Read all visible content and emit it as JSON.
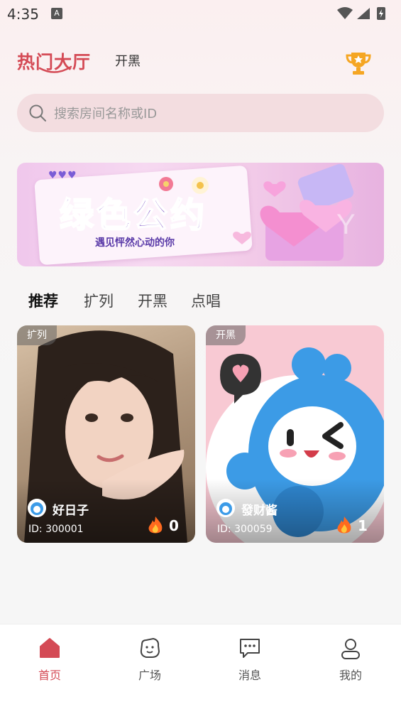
{
  "status_bar": {
    "time": "4:35",
    "notification_icon": "A"
  },
  "header": {
    "title": "热门大厅",
    "secondary_tab": "开黑",
    "trophy_icon": "trophy-icon"
  },
  "search": {
    "placeholder": "搜索房间名称或ID",
    "value": ""
  },
  "banner": {
    "title": "绿色公约",
    "subtitle": "遇见怦然心动的你"
  },
  "categories": [
    {
      "label": "推荐",
      "active": true
    },
    {
      "label": "扩列",
      "active": false
    },
    {
      "label": "开黑",
      "active": false
    },
    {
      "label": "点唱",
      "active": false
    }
  ],
  "rooms": [
    {
      "tag": "扩列",
      "name": "好日子",
      "id": "ID: 300001",
      "heat": "0"
    },
    {
      "tag": "开黑",
      "name": "發财酱",
      "id": "ID: 300059",
      "heat": "1"
    }
  ],
  "bottom_nav": [
    {
      "label": "首页",
      "icon": "home-icon",
      "active": true
    },
    {
      "label": "广场",
      "icon": "plaza-icon",
      "active": false
    },
    {
      "label": "消息",
      "icon": "message-icon",
      "active": false
    },
    {
      "label": "我的",
      "icon": "profile-icon",
      "active": false
    }
  ],
  "colors": {
    "accent": "#d44a55",
    "search_bg": "#f3dde0",
    "banner_text": "#6c3cbf"
  }
}
